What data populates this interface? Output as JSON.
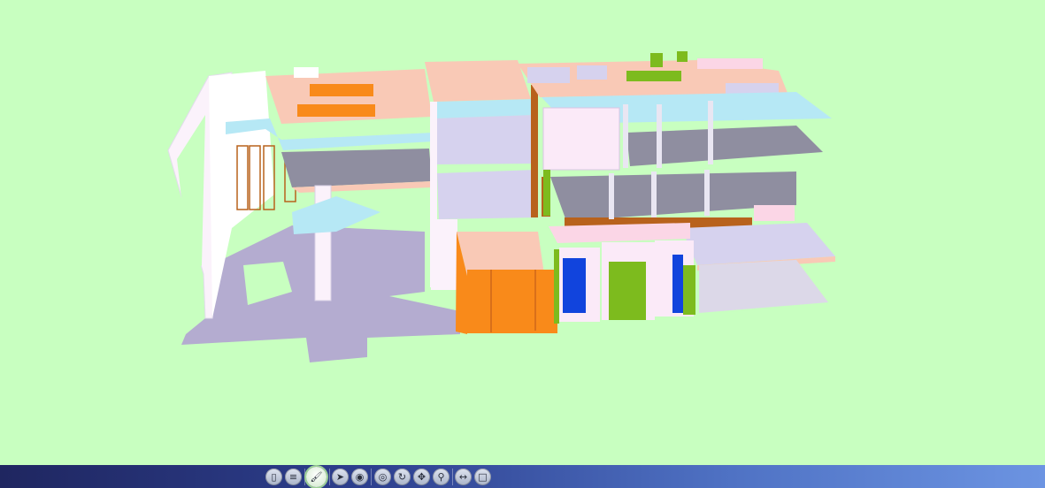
{
  "viewer": {
    "background_color": "#c8ffc0",
    "model": {
      "colors": {
        "slab": "#f9c9b6",
        "floor_gray": "#8f8ea0",
        "floor_lavender": "#d6d2ee",
        "ground_shadow": "#b4acd0",
        "wall_white": "#fbf2fb",
        "glass_cyan": "#b6e8f5",
        "orange": "#f98a1a",
        "green": "#7dbb1e",
        "blue": "#1144dd",
        "wood": "#b8621c"
      }
    }
  },
  "toolbar": {
    "buttons": [
      {
        "name": "bookmark-button",
        "icon": "bookmark-icon",
        "glyph": "▯",
        "active": false
      },
      {
        "name": "layers-button",
        "icon": "list-icon",
        "glyph": "≡",
        "active": false
      },
      {
        "name": "paint-button",
        "icon": "paintbrush-icon",
        "glyph": "🖌",
        "active": true
      },
      {
        "name": "select-button",
        "icon": "pointer-icon",
        "glyph": "➤",
        "active": false
      },
      {
        "name": "target-button",
        "icon": "target-icon",
        "glyph": "◉",
        "active": false
      },
      {
        "name": "visibility-button",
        "icon": "eye-icon",
        "glyph": "◎",
        "active": false
      },
      {
        "name": "rotate-button",
        "icon": "rotate-icon",
        "glyph": "↻",
        "active": false
      },
      {
        "name": "pan-button",
        "icon": "move-icon",
        "glyph": "✥",
        "active": false
      },
      {
        "name": "zoom-button",
        "icon": "magnifier-icon",
        "glyph": "⚲",
        "active": false
      },
      {
        "name": "measure-button",
        "icon": "arrows-horizontal-icon",
        "glyph": "↔",
        "active": false
      },
      {
        "name": "section-box-button",
        "icon": "square-icon",
        "glyph": "□",
        "active": false
      }
    ]
  }
}
